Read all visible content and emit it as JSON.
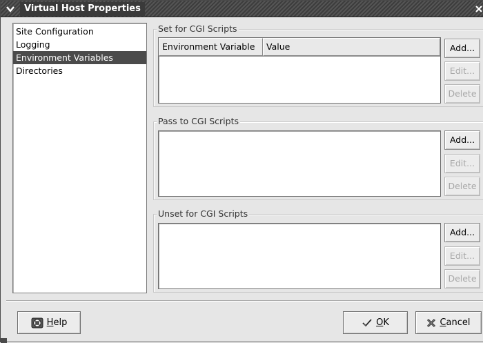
{
  "window": {
    "title": "Virtual Host Properties"
  },
  "sidebar": {
    "items": [
      {
        "label": "Site Configuration",
        "selected": false
      },
      {
        "label": "Logging",
        "selected": false
      },
      {
        "label": "Environment Variables",
        "selected": true
      },
      {
        "label": "Directories",
        "selected": false
      }
    ]
  },
  "sections": [
    {
      "label": "Set for CGI Scripts",
      "columns": [
        "Environment Variable",
        "Value"
      ],
      "buttons": {
        "add": "Add...",
        "edit": "Edit...",
        "delete": "Delete"
      }
    },
    {
      "label": "Pass to CGI Scripts",
      "columns": [],
      "buttons": {
        "add": "Add...",
        "edit": "Edit...",
        "delete": "Delete"
      }
    },
    {
      "label": "Unset for CGI Scripts",
      "columns": [],
      "buttons": {
        "add": "Add...",
        "edit": "Edit...",
        "delete": "Delete"
      }
    }
  ],
  "footer": {
    "help_mnemonic": "H",
    "help_rest": "elp",
    "ok_mnemonic": "O",
    "ok_rest": "K",
    "cancel_mnemonic": "C",
    "cancel_rest": "ancel"
  },
  "icons": {
    "window_menu": "chevron-down-icon",
    "close": "close-icon",
    "help": "lifebuoy-icon",
    "ok": "checkmark-icon",
    "cancel": "x-icon"
  }
}
